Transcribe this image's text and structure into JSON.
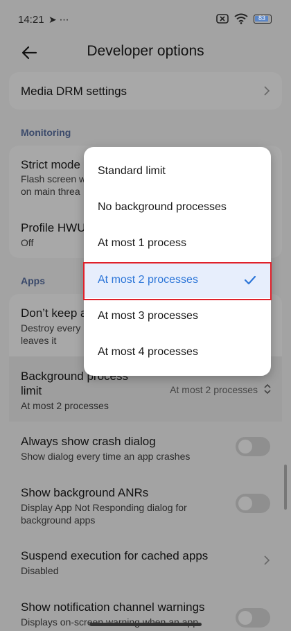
{
  "status": {
    "time": "14:21",
    "battery": "83"
  },
  "header": {
    "title": "Developer options"
  },
  "items": {
    "media_drm": "Media DRM settings",
    "monitoring_label": "Monitoring",
    "strict_mode_title": "Strict mode",
    "strict_mode_sub1": "Flash screen w",
    "strict_mode_sub2": "on main threa",
    "profile_hwui_title": "Profile HWU",
    "profile_hwui_sub": "Off",
    "apps_label": "Apps",
    "dont_keep_title": "Don’t keep a",
    "dont_keep_sub1": "Destroy every",
    "dont_keep_sub2": "leaves it",
    "bg_limit_title1": "Background process",
    "bg_limit_title2": "limit",
    "bg_limit_sub": "At most 2 processes",
    "bg_limit_value": "At most 2 processes",
    "crash_title": "Always show crash dialog",
    "crash_sub": "Show dialog every time an app crashes",
    "anr_title": "Show background ANRs",
    "anr_sub1": "Display App Not Responding dialog for",
    "anr_sub2": "background apps",
    "suspend_title": "Suspend execution for cached apps",
    "suspend_sub": "Disabled",
    "notif_title": "Show notification channel warnings",
    "notif_sub1": "Displays on-screen warning when an app"
  },
  "menu": {
    "options": [
      "Standard limit",
      "No background processes",
      "At most 1 process",
      "At most 2 processes",
      "At most 3 processes",
      "At most 4 processes"
    ],
    "selected_index": 3
  },
  "colors": {
    "accent": "#2d76d8",
    "highlight": "#e0202a"
  },
  "toggles": {
    "crash_dialog": false,
    "background_anrs": false,
    "notification_warnings": false
  }
}
